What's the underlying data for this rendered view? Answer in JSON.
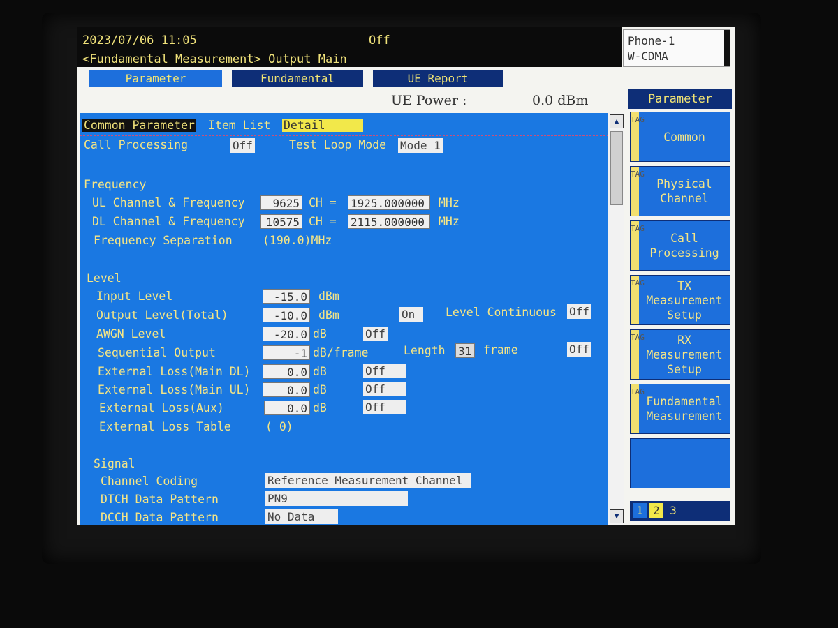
{
  "header": {
    "datetime": "2023/07/06 11:05",
    "status": "Off",
    "path": "<Fundamental Measurement> Output Main"
  },
  "phone_box": {
    "line1": "Phone-1",
    "line2": "W-CDMA"
  },
  "tabs": [
    {
      "label": "Parameter"
    },
    {
      "label": "Fundamental"
    },
    {
      "label": "UE Report"
    }
  ],
  "ue_power": {
    "label": "UE Power :",
    "value": "0.0 dBm"
  },
  "top_row": {
    "common_param": "Common Parameter",
    "item_list": "Item List",
    "detail": "Detail"
  },
  "call_processing": {
    "label": "Call Processing",
    "value": "Off",
    "test_loop_label": "Test Loop Mode",
    "test_loop_value": "Mode 1"
  },
  "frequency": {
    "heading": "Frequency",
    "ul_label": "UL Channel & Frequency",
    "ul_ch": "9625",
    "ul_freq": "1925.000000",
    "dl_label": "DL Channel & Frequency",
    "dl_ch": "10575",
    "dl_freq": "2115.000000",
    "ch_eq": "CH =",
    "unit": "MHz",
    "sep_label": "Frequency Separation",
    "sep_value": "(190.0)MHz"
  },
  "level": {
    "heading": "Level",
    "input_label": "Input Level",
    "input_value": "-15.0",
    "input_unit": "dBm",
    "output_label": "Output Level(Total)",
    "output_value": "-10.0",
    "output_unit": "dBm",
    "output_state": "On",
    "continuous_label": "Level Continuous",
    "continuous_value": "Off",
    "awgn_label": "AWGN Level",
    "awgn_value": "-20.0",
    "awgn_unit": "dB",
    "awgn_state": "Off",
    "seq_label": "Sequential Output",
    "seq_value": "-1",
    "seq_unit": "dB/frame",
    "length_label": "Length",
    "length_value": "31",
    "length_unit": "frame",
    "seq_state": "Off",
    "ext_dl_label": "External Loss(Main DL)",
    "ext_dl_value": "0.0",
    "ext_dl_unit": "dB",
    "ext_dl_state": "Off",
    "ext_ul_label": "External Loss(Main UL)",
    "ext_ul_value": "0.0",
    "ext_ul_unit": "dB",
    "ext_ul_state": "Off",
    "ext_aux_label": "External Loss(Aux)",
    "ext_aux_value": "0.0",
    "ext_aux_unit": "dB",
    "ext_aux_state": "Off",
    "ext_table_label": "External Loss Table",
    "ext_table_value": "( 0)"
  },
  "signal": {
    "heading": "Signal",
    "coding_label": "Channel Coding",
    "coding_value": "Reference Measurement Channel",
    "dtch_label": "DTCH Data Pattern",
    "dtch_value": "PN9",
    "dcch_label": "DCCH Data Pattern",
    "dcch_value": "No Data"
  },
  "softkeys": {
    "title": "Parameter",
    "tag": "TAG",
    "items": [
      {
        "label": "Common"
      },
      {
        "label": "Physical\nChannel"
      },
      {
        "label": "Call\nProcessing"
      },
      {
        "label": "TX\nMeasurement\nSetup"
      },
      {
        "label": "RX\nMeasurement\nSetup"
      },
      {
        "label": "Fundamental\nMeasurement"
      },
      {
        "label": ""
      }
    ],
    "pages": [
      "1",
      "2",
      "3"
    ]
  },
  "scroll_icons": {
    "up": "triangle-up-icon",
    "down": "triangle-down-icon"
  },
  "colors": {
    "panel_blue": "#1a78e2",
    "text_yellow": "#f4e586",
    "header_black": "#0b0b0b",
    "tab_dark": "#0e2e77"
  }
}
